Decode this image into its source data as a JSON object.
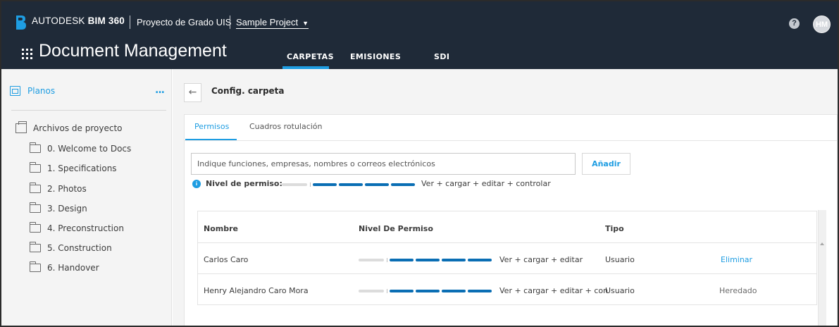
{
  "header": {
    "brand_prefix": "AUTODESK",
    "brand_product": "BIM 360",
    "project": "Proyecto de Grado UIS",
    "sample_project": "Sample Project",
    "app_title": "Document Management",
    "tabs": [
      {
        "label": "CARPETAS",
        "active": true
      },
      {
        "label": "EMISIONES",
        "active": false
      },
      {
        "label": "SDI",
        "active": false
      }
    ],
    "help_icon": "?",
    "avatar": "HM",
    "accent_color": "#1e9de2",
    "header_color": "#1f2a38"
  },
  "sidebar": {
    "planos_label": "Planos",
    "more_icon": "...",
    "archivos_label": "Archivos de proyecto",
    "folders": [
      "0. Welcome to Docs",
      "1. Specifications",
      "2. Photos",
      "3. Design",
      "4. Preconstruction",
      "5. Construction",
      "6. Handover"
    ]
  },
  "main": {
    "back_icon": "←",
    "page_title": "Config. carpeta",
    "tabs": [
      {
        "label": "Permisos",
        "active": true
      },
      {
        "label": "Cuadros rotulación",
        "active": false
      }
    ],
    "search_placeholder": "Indique funciones, empresas, nombres o correos electrónicos",
    "add_button": "Añadir",
    "info_icon": "i",
    "permission_label": "Nivel de permiso:",
    "permission_value": "Ver + cargar + editar + controlar",
    "permission_level_filled_segments": 4,
    "table": {
      "headers": [
        "Nombre",
        "Nivel De Permiso",
        "Tipo"
      ],
      "rows": [
        {
          "name": "Carlos Caro",
          "level_text": "Ver + cargar + editar",
          "filled_segments": 4,
          "type": "Usuario",
          "action": "Eliminar"
        },
        {
          "name": "Henry Alejandro Caro Mora",
          "level_text": "Ver + cargar + editar + con",
          "filled_segments": 4,
          "type": "Usuario",
          "action": "Heredado"
        }
      ]
    }
  }
}
